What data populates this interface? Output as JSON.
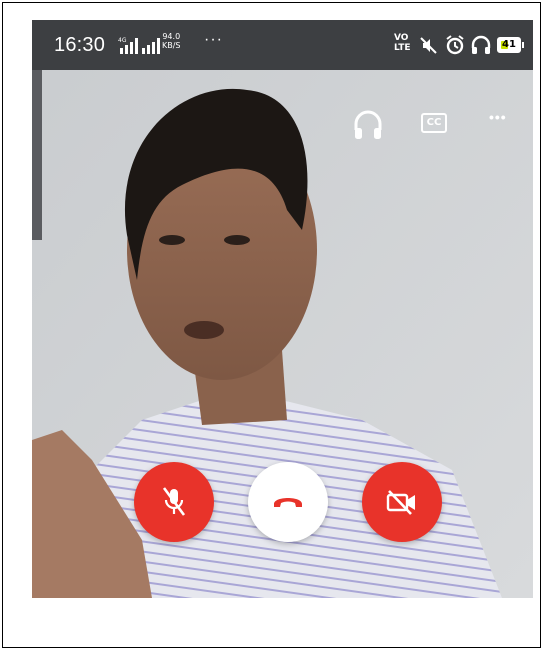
{
  "status_bar": {
    "time": "16:30",
    "network_type": "4G",
    "data_speed_value": "94.0",
    "data_speed_unit": "KB/S",
    "more_indicator": "···",
    "volte": [
      "VO",
      "LTE"
    ],
    "battery_level": "41",
    "battery_fraction": 0.41,
    "icons": [
      "signal-icon",
      "signal-icon",
      "mute-icon",
      "alarm-icon",
      "headset-icon",
      "battery-icon"
    ]
  },
  "call_actions": {
    "top": [
      "headset-icon",
      "captions-icon",
      "more-options-icon"
    ],
    "captions_label": "CC",
    "more_label": "•••"
  },
  "controls": {
    "mute": {
      "icon": "mic-off-icon",
      "color": "#e8332a"
    },
    "end_call": {
      "icon": "end-call-icon",
      "color": "#ffffff",
      "icon_color": "#e8332a"
    },
    "video": {
      "icon": "video-off-icon",
      "color": "#e8332a"
    }
  },
  "colors": {
    "status_bar_bg": "#3d3f42",
    "accent_red": "#e8332a"
  }
}
